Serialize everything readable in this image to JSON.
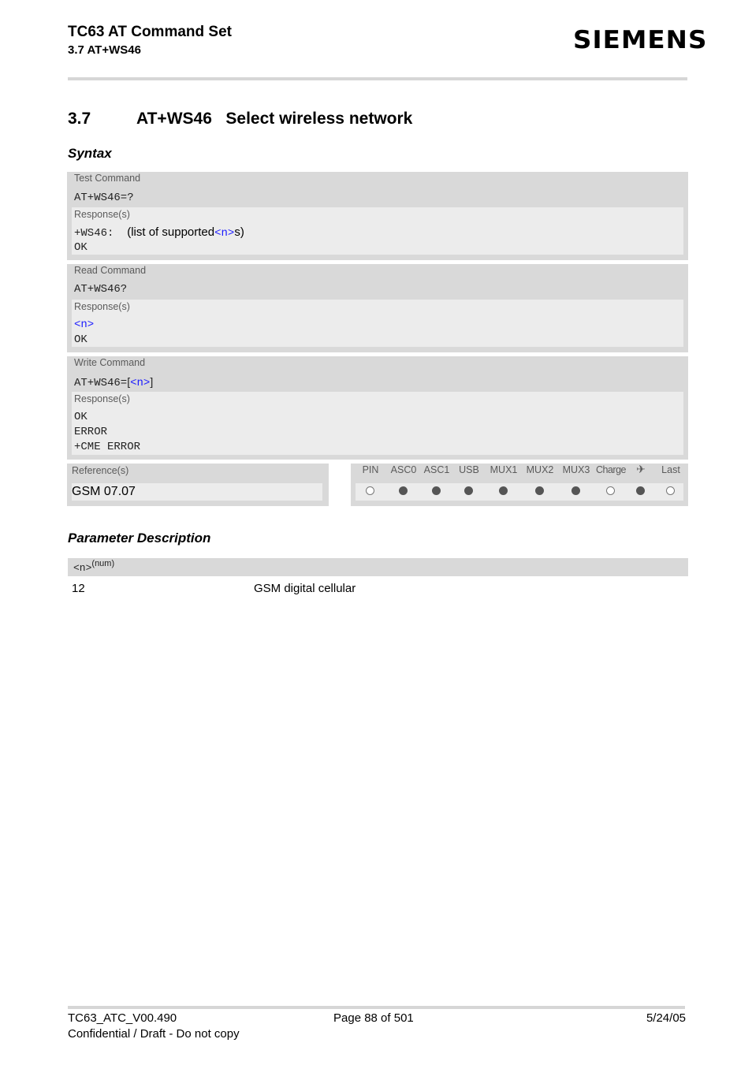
{
  "header": {
    "title": "TC63 AT Command Set",
    "subtitle": "3.7 AT+WS46",
    "logo": "SIEMENS"
  },
  "section": {
    "number": "3.7",
    "title": "AT+WS46   Select wireless network"
  },
  "syntax_heading": "Syntax",
  "commands": [
    {
      "label": "Test Command",
      "command": "AT+WS46=?",
      "response_label": "Response(s)",
      "responses": {
        "line1_prefix": "+WS46: ",
        "line1_text": "(list of supported",
        "line1_param": "<n>",
        "line1_suffix": "s)",
        "line2": "OK"
      }
    },
    {
      "label": "Read Command",
      "command": "AT+WS46?",
      "response_label": "Response(s)",
      "responses": {
        "line1_param": "<n>",
        "line2": "OK"
      }
    },
    {
      "label": "Write Command",
      "command_prefix": "AT+WS46=",
      "command_open": "[",
      "command_param": "<n>",
      "command_close": "]",
      "response_label": "Response(s)",
      "responses": {
        "line1": "OK",
        "line2": "ERROR",
        "line3": "+CME ERROR"
      }
    }
  ],
  "reference": {
    "label": "Reference(s)",
    "value": "GSM 07.07"
  },
  "interfaces": [
    {
      "label": "PIN",
      "supported": false
    },
    {
      "label": "ASC0",
      "supported": true
    },
    {
      "label": "ASC1",
      "supported": true
    },
    {
      "label": "USB",
      "supported": true
    },
    {
      "label": "MUX1",
      "supported": true
    },
    {
      "label": "MUX2",
      "supported": true
    },
    {
      "label": "MUX3",
      "supported": true
    },
    {
      "label": "Charge",
      "supported": false
    },
    {
      "label": "✈",
      "icon": "airplane-icon",
      "supported": true
    },
    {
      "label": "Last",
      "supported": false
    }
  ],
  "parameter_heading": "Parameter Description",
  "parameter": {
    "name": "<n>",
    "type": "(num)",
    "values": [
      {
        "value": "12",
        "description": "GSM digital cellular"
      }
    ]
  },
  "footer": {
    "doc_id": "TC63_ATC_V00.490",
    "page": "Page 88 of 501",
    "date": "5/24/05",
    "confidential": "Confidential / Draft - Do not copy"
  }
}
